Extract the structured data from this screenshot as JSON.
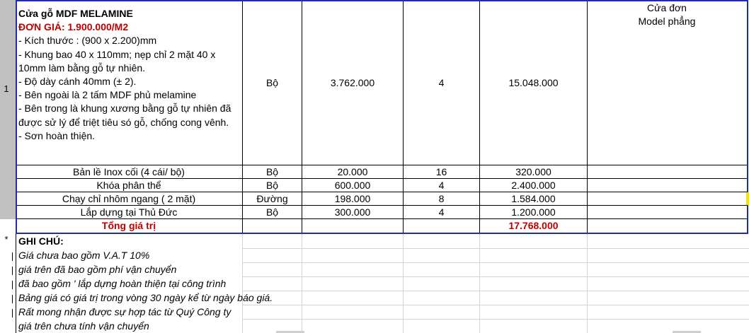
{
  "item": {
    "row_number": "1",
    "title": "Cửa gỗ MDF MELAMINE",
    "price_line": "ĐƠN GIÁ: 1.900.000/M2",
    "lines": [
      "- Kích thước : (900 x 2.200)mm",
      "- Khung bao 40 x 110mm; nẹp chỉ 2 mặt 40 x",
      "10mm làm bằng gỗ tự nhiên.",
      "- Độ dày cánh 40mm (± 2).",
      "- Bên ngoài là 2 tấm MDF phủ melamine",
      "- Bên trong là khung xương bằng gỗ tự nhiên đã",
      "được sử lý để triệt tiêu só gỗ, chống cong vênh.",
      "- Sơn hoàn thiện."
    ],
    "unit": "Bộ",
    "unit_price": "3.762.000",
    "quantity": "4",
    "total": "15.048.000",
    "note_line1": "Cửa đơn",
    "note_line2": "Model phẳng"
  },
  "accessories": [
    {
      "name": "Bản lề Inox cối (4 cái/ bộ)",
      "unit": "Bộ",
      "price": "20.000",
      "qty": "16",
      "total": "320.000"
    },
    {
      "name": "Khóa phân thể",
      "unit": "Bộ",
      "price": "600.000",
      "qty": "4",
      "total": "2.400.000"
    },
    {
      "name": "Chạy chỉ nhôm ngang ( 2 mặt)",
      "unit": "Đường",
      "price": "198.000",
      "qty": "8",
      "total": "1.584.000"
    },
    {
      "name": "Lắp dựng tại Thủ Đức",
      "unit": "Bộ",
      "price": "300.000",
      "qty": "4",
      "total": "1.200.000"
    }
  ],
  "grand_total": {
    "label": "Tổng giá trị",
    "value": "17.768.000"
  },
  "notes": {
    "marker": "*",
    "heading": "GHI CHÚ:",
    "lines": [
      "Giá chưa bao gồm V.A.T 10%",
      "giá trên đã bao gồm phí vận chuyển",
      "đã bao gồm ' lắp dựng hoàn thiện tại công trình",
      "Bảng giá có giá trị trong vòng 30 ngày kể từ ngày báo giá.",
      "Rất mong nhận được sự hợp tác từ Quý Công ty",
      "giá trên chưa tính vận chuyển"
    ]
  },
  "colors": {
    "highlight_red": "#c00000",
    "selection_blue": "#1f2fa0",
    "header_gray": "#c0c0c0"
  }
}
